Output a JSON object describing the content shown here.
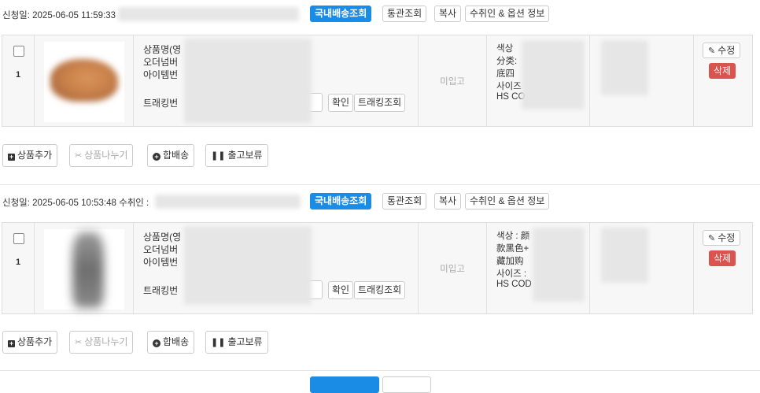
{
  "orders": [
    {
      "meta_prefix": "신청일: 2025-06-05 11:59:33",
      "buttons": {
        "domestic_tracking": "국내배송조회",
        "customs": "통관조회",
        "copy": "복사",
        "recipient_options": "수취인 & 옵션 정보"
      },
      "item": {
        "index": "1",
        "image_icon": "shoe-product-image",
        "product_name_label": "상품명(영",
        "order_number_label": "오더넘버",
        "item_number_label": "아이템번",
        "tracking_label": "트래킹번",
        "confirm": "확인",
        "tracking_lookup": "트래킹조회",
        "status": "미입고",
        "options": [
          "색상",
          "分类:",
          "底四",
          "사이즈",
          "HS CO"
        ],
        "edit": "수정",
        "delete": "삭제"
      },
      "actions": {
        "add_product": "상품추가",
        "split_product": "상품나누기",
        "combine_shipping": "합배송",
        "hold_shipping": "출고보류"
      }
    },
    {
      "meta_prefix": "신청일: 2025-06-05 10:53:48 수취인 :",
      "buttons": {
        "domestic_tracking": "국내배송조회",
        "customs": "통관조회",
        "copy": "복사",
        "recipient_options": "수취인 & 옵션 정보"
      },
      "item": {
        "index": "1",
        "image_icon": "coat-product-image",
        "product_name_label": "상품명(영",
        "order_number_label": "오더넘버",
        "item_number_label": "아이템번",
        "tracking_label": "트래킹번",
        "confirm": "확인",
        "tracking_lookup": "트래킹조회",
        "status": "미입고",
        "options": [
          "색상 : 颜",
          "款黑色+",
          "藏加购",
          "사이즈 :",
          "HS COD"
        ],
        "edit": "수정",
        "delete": "삭제"
      },
      "actions": {
        "add_product": "상품추가",
        "split_product": "상품나누기",
        "combine_shipping": "합배송",
        "hold_shipping": "출고보류"
      }
    }
  ],
  "colors": {
    "primary": "#1a8ce6",
    "danger": "#d9534f",
    "row_bg": "#f7f7f7",
    "muted": "#aaaaaa"
  }
}
